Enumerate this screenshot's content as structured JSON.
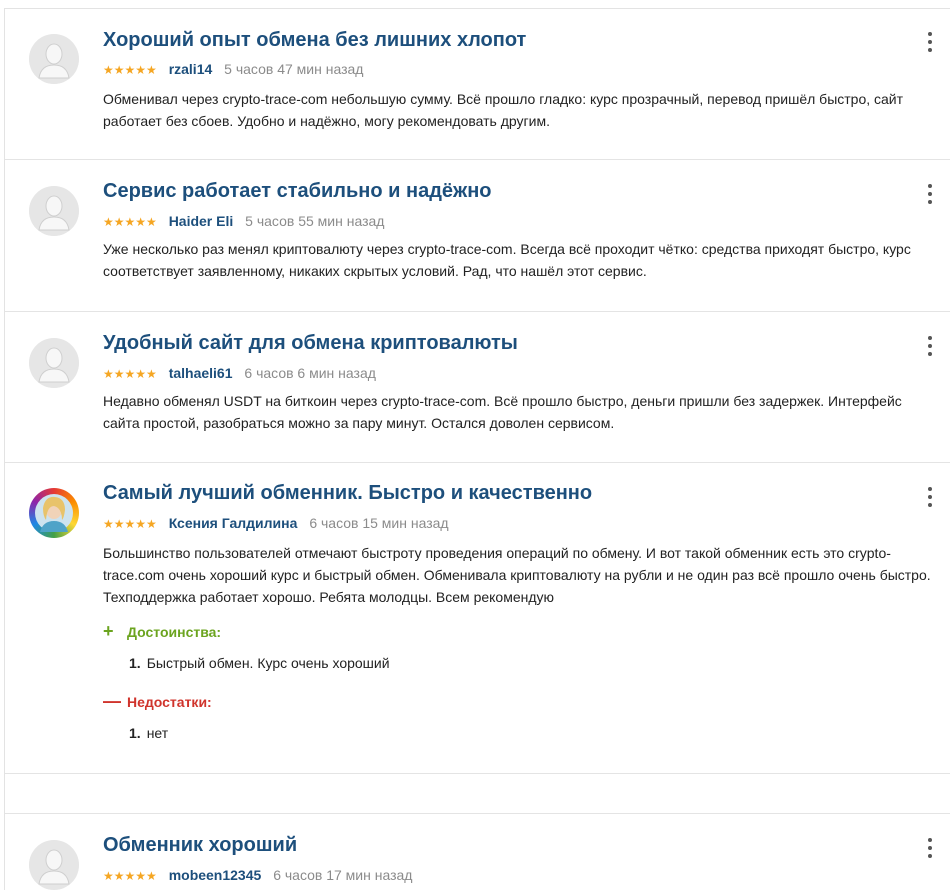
{
  "reviews": [
    {
      "title": "Хороший опыт обмена без лишних хлопот",
      "stars": "★★★★★",
      "author": "rzali14",
      "time": "5 часов 47 мин назад",
      "text": "Обменивал через crypto-trace-com небольшую сумму. Всё прошло гладко: курс прозрачный, перевод пришёл быстро, сайт работает без сбоев. Удобно и надёжно, могу рекомендовать другим."
    },
    {
      "title": "Сервис работает стабильно и надёжно",
      "stars": "★★★★★",
      "author": "Haider Eli",
      "time": "5 часов 55 мин назад",
      "text": "Уже несколько раз менял криптовалюту через crypto-trace-com. Всегда всё проходит чётко: средства приходят быстро, курс соответствует заявленному, никаких скрытых условий. Рад, что нашёл этот сервис."
    },
    {
      "title": "Удобный сайт для обмена криптовалюты",
      "stars": "★★★★★",
      "author": "talhaeli61",
      "time": "6 часов 6 мин назад",
      "text": "Недавно обменял USDT на биткоин через crypto-trace-com. Всё прошло быстро, деньги пришли без задержек. Интерфейс сайта простой, разобраться можно за пару минут. Остался доволен сервисом."
    },
    {
      "title": "Самый лучший обменник. Быстро и качественно",
      "stars": "★★★★★",
      "author": "Ксения Галдилина",
      "time": "6 часов 15 мин назад",
      "text": "Большинство пользователей отмечают быстроту проведения операций по обмену. И вот такой обменник есть это crypto-trace.com очень хороший курс и быстрый обмен. Обменивала криптовалюту на рубли и не один раз всё прошло очень быстро. Техподдержка работает хорошо. Ребята молодцы. Всем рекомендую",
      "pros_label": "Достоинства:",
      "pros_sign": "+",
      "pros": [
        {
          "num": "1.",
          "text": "Быстрый обмен. Курс очень хороший"
        }
      ],
      "cons_label": "Недостатки:",
      "cons_sign": "—",
      "cons": [
        {
          "num": "1.",
          "text": "нет"
        }
      ]
    },
    {
      "title": "Обменник хороший",
      "stars": "★★★★★",
      "author": "mobeen12345",
      "time": "6 часов 17 мин назад"
    }
  ],
  "colors": {
    "title": "#1d4f7c",
    "stars": "#f5a623",
    "pros": "#6ba41f",
    "cons": "#d0342c"
  }
}
